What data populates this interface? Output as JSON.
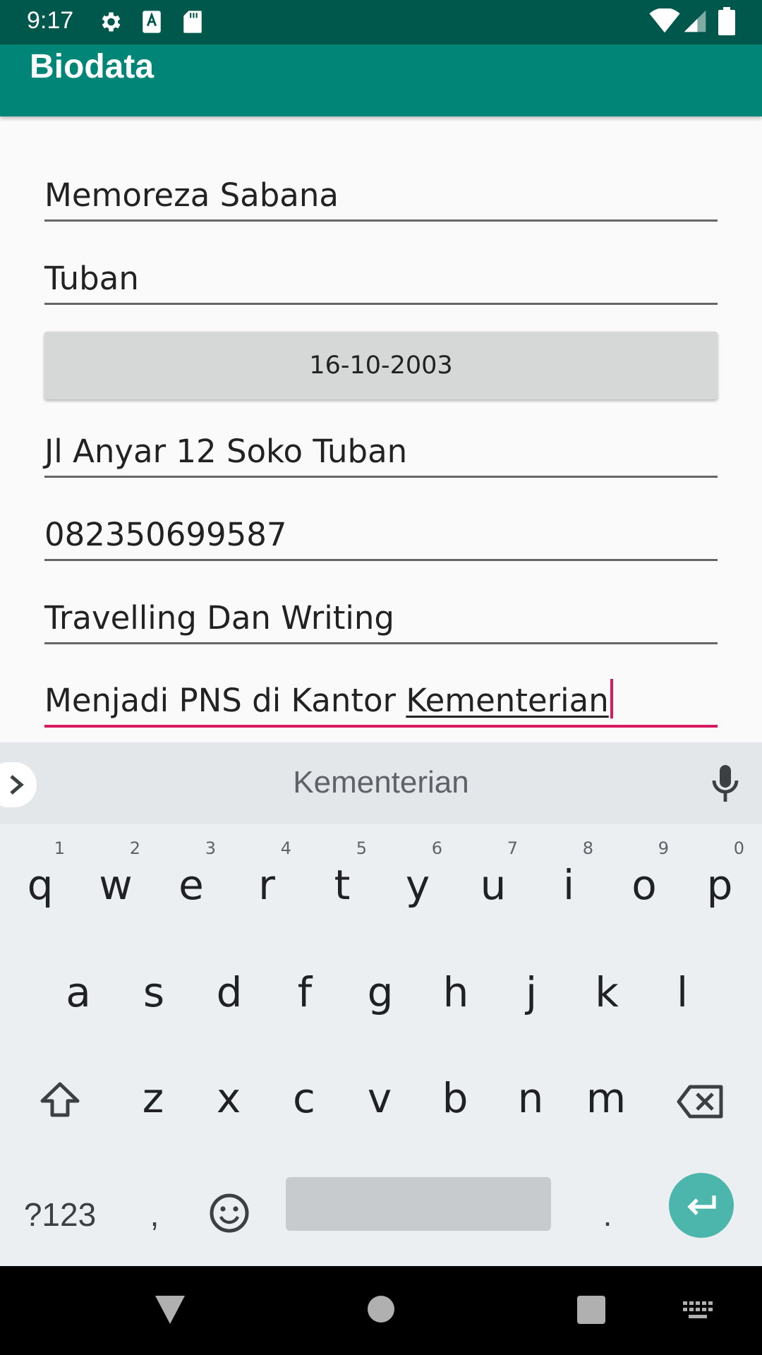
{
  "status_bar": {
    "time": "9:17"
  },
  "app_bar": {
    "title": "Biodata"
  },
  "form": {
    "name": "Memoreza Sabana",
    "birthplace": "Tuban",
    "birthdate": "16-10-2003",
    "address": "Jl Anyar 12 Soko Tuban",
    "phone": "082350699587",
    "hobby": "Travelling Dan Writing",
    "goal_prefix": "Menjadi PNS di Kantor ",
    "goal_composing": "Kementerian"
  },
  "keyboard": {
    "suggestion": "Kementerian",
    "row1": [
      {
        "label": "q",
        "hint": "1"
      },
      {
        "label": "w",
        "hint": "2"
      },
      {
        "label": "e",
        "hint": "3"
      },
      {
        "label": "r",
        "hint": "4"
      },
      {
        "label": "t",
        "hint": "5"
      },
      {
        "label": "y",
        "hint": "6"
      },
      {
        "label": "u",
        "hint": "7"
      },
      {
        "label": "i",
        "hint": "8"
      },
      {
        "label": "o",
        "hint": "9"
      },
      {
        "label": "p",
        "hint": "0"
      }
    ],
    "row2": [
      "a",
      "s",
      "d",
      "f",
      "g",
      "h",
      "j",
      "k",
      "l"
    ],
    "row3": [
      "z",
      "x",
      "c",
      "v",
      "b",
      "n",
      "m"
    ],
    "symbols_label": "?123",
    "comma_label": ",",
    "period_label": "."
  },
  "colors": {
    "status_bar": "#00574b",
    "app_bar": "#008577",
    "accent": "#d81b60",
    "enter_key": "#4db6ac"
  },
  "icons": [
    "settings-icon",
    "accessibility-icon",
    "sd-card-icon",
    "wifi-icon",
    "signal-icon",
    "battery-icon",
    "chevron-right-icon",
    "mic-icon",
    "shift-icon",
    "backspace-icon",
    "emoji-icon",
    "enter-icon",
    "back-icon",
    "home-icon",
    "recents-icon",
    "keyboard-switch-icon"
  ]
}
